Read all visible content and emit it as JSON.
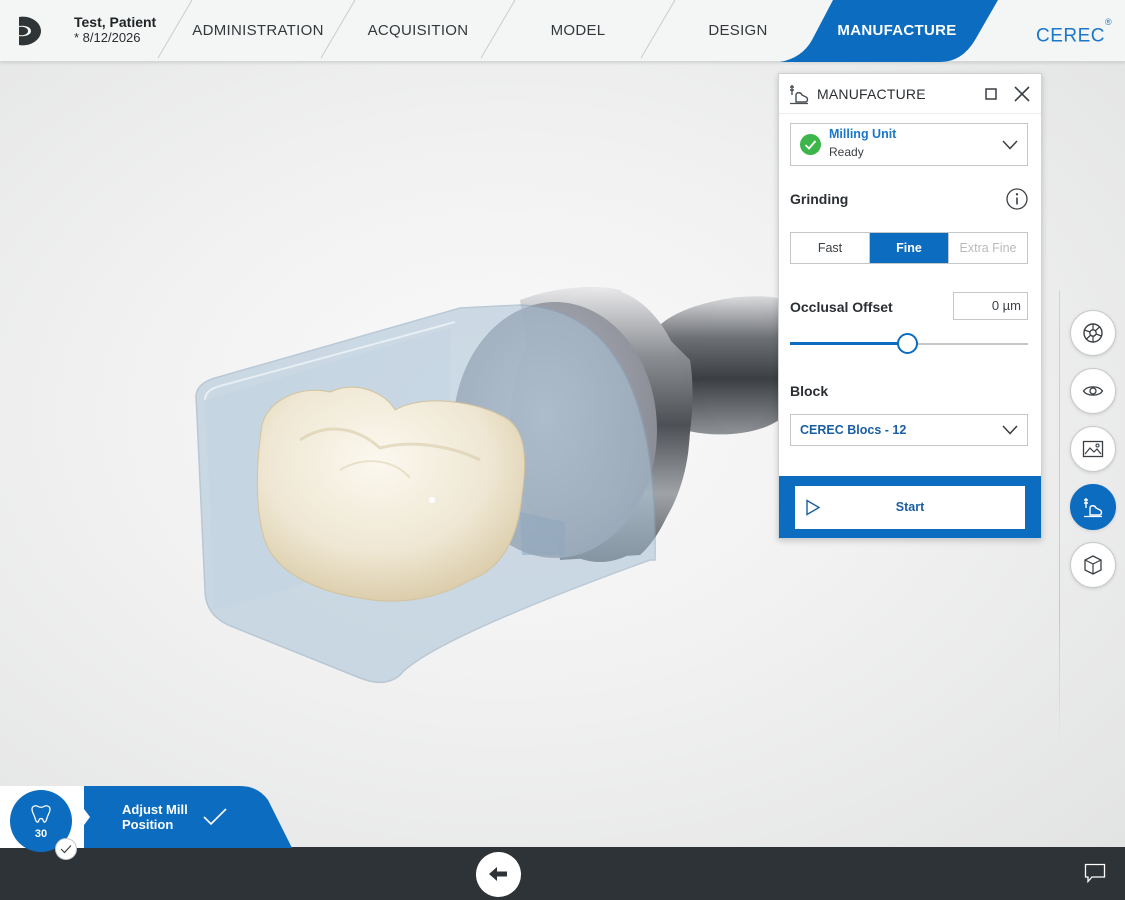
{
  "header": {
    "patient_name": "Test, Patient",
    "patient_date": "* 8/12/2026",
    "tabs": [
      {
        "label": "ADMINISTRATION",
        "active": false
      },
      {
        "label": "ACQUISITION",
        "active": false
      },
      {
        "label": "MODEL",
        "active": false
      },
      {
        "label": "DESIGN",
        "active": false
      },
      {
        "label": "MANUFACTURE",
        "active": true
      }
    ],
    "brand": "CEREC",
    "brand_mark": "®"
  },
  "panel": {
    "title": "MANUFACTURE",
    "header_icon": "milling-icon",
    "milling_unit": {
      "label": "Milling Unit",
      "status": "Ready",
      "status_color": "#3cb54a"
    },
    "grinding": {
      "label": "Grinding",
      "options": [
        "Fast",
        "Fine",
        "Extra Fine"
      ],
      "selected": "Fine"
    },
    "occlusal_offset": {
      "label": "Occlusal Offset",
      "value": "0 µm",
      "slider_fraction": 0.49
    },
    "block": {
      "label": "Block",
      "selected": "CEREC Blocs - 12"
    },
    "start_label": "Start"
  },
  "tools": [
    {
      "icon": "restoration-wheel-icon",
      "active": false
    },
    {
      "icon": "eye-icon",
      "active": false
    },
    {
      "icon": "image-view-icon",
      "active": false
    },
    {
      "icon": "milling-icon",
      "active": true
    },
    {
      "icon": "cube-icon",
      "active": false
    }
  ],
  "step": {
    "icon": "tooth-icon",
    "number": "30",
    "label_line1": "Adjust Mill",
    "label_line2": "Position"
  },
  "colors": {
    "accent": "#0b6cc0",
    "brand": "#1a77c9",
    "bottom_bar": "#2e3338"
  }
}
